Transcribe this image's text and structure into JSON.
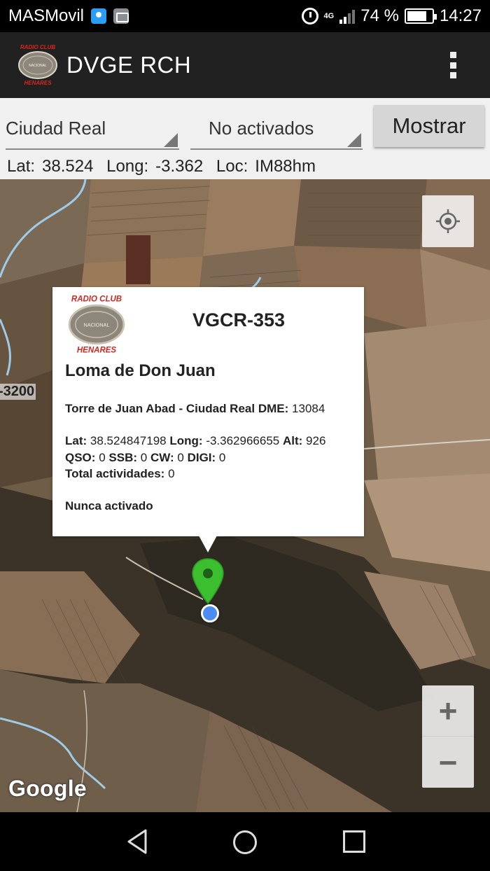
{
  "status_bar": {
    "carrier": "MASMovil",
    "network": "4G",
    "battery": "74 %",
    "time": "14:27"
  },
  "app_bar": {
    "title": "DVGE RCH",
    "logo_text": {
      "top": "RADIO CLUB",
      "center": "NACIONAL",
      "bottom": "HENARES"
    },
    "menu_icon": "overflow-menu-icon"
  },
  "filters": {
    "province": "Ciudad Real",
    "status": "No activados",
    "show_button": "Mostrar"
  },
  "coords_bar": {
    "lat_label": "Lat:",
    "lat_value": "38.524",
    "long_label": "Long:",
    "long_value": "-3.362",
    "loc_label": "Loc:",
    "loc_value": "IM88hm"
  },
  "map": {
    "road_label": "-3200",
    "attribution": "Google",
    "my_location_icon": "crosshair-icon",
    "zoom_in": "+",
    "zoom_out": "−"
  },
  "info_window": {
    "id": "VGCR-353",
    "name": "Loma de Don Juan",
    "location": "Torre de Juan Abad - Ciudad Real",
    "dme_label": "DME:",
    "dme_value": "13084",
    "lat_label": "Lat:",
    "lat_value": "38.524847198",
    "long_label": "Long:",
    "long_value": "-3.362966655",
    "alt_label": "Alt:",
    "alt_value": "926",
    "qso_label": "QSO:",
    "qso_value": "0",
    "ssb_label": "SSB:",
    "ssb_value": "0",
    "cw_label": "CW:",
    "cw_value": "0",
    "digi_label": "DIGI:",
    "digi_value": "0",
    "total_label": "Total actividades:",
    "total_value": "0",
    "status_text": "Nunca activado"
  },
  "colors": {
    "app_bar": "#212121",
    "filter_bg": "#f0f0f0",
    "marker": "#3bbf2f",
    "location_dot": "#4a8cf0",
    "logo_red": "#d8261f"
  }
}
